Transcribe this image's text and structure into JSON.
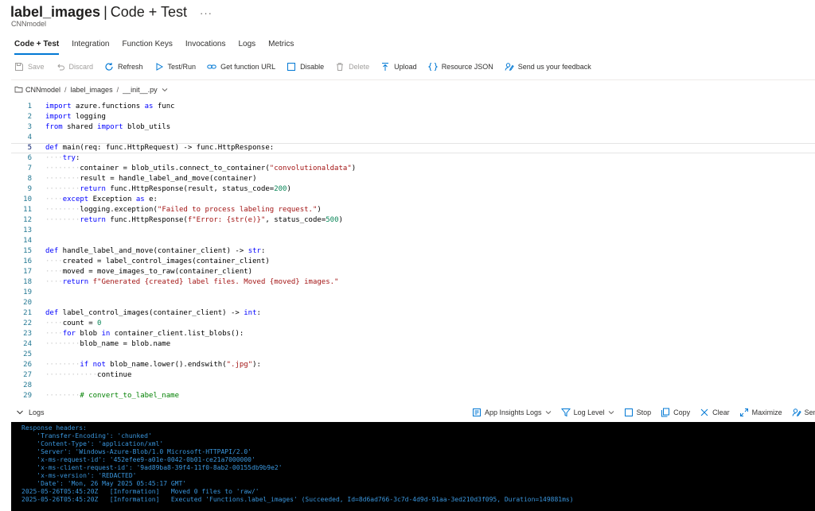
{
  "header": {
    "title": "label_images",
    "separator": "|",
    "title_suffix": "Code + Test",
    "more": "···",
    "subtitle": "CNNmodel"
  },
  "tabs": [
    {
      "label": "Code + Test",
      "active": true
    },
    {
      "label": "Integration"
    },
    {
      "label": "Function Keys"
    },
    {
      "label": "Invocations"
    },
    {
      "label": "Logs"
    },
    {
      "label": "Metrics"
    }
  ],
  "toolbar": {
    "save": "Save",
    "discard": "Discard",
    "refresh": "Refresh",
    "test_run": "Test/Run",
    "get_url": "Get function URL",
    "disable": "Disable",
    "delete": "Delete",
    "upload": "Upload",
    "resource_json": "Resource JSON",
    "feedback": "Send us your feedback"
  },
  "breadcrumb": {
    "root": "CNNmodel",
    "function": "label_images",
    "file": "__init__.py"
  },
  "editor": {
    "current_line": 5,
    "lines": [
      {
        "n": "1",
        "c": "import azure.functions as func"
      },
      {
        "n": "2",
        "c": "import logging"
      },
      {
        "n": "3",
        "c": "from shared import blob_utils"
      },
      {
        "n": "4",
        "c": ""
      },
      {
        "n": "5",
        "c": "def main(req: func.HttpRequest) -> func.HttpResponse:"
      },
      {
        "n": "6",
        "c": "    try:"
      },
      {
        "n": "7",
        "c": "        container = blob_utils.connect_to_container(\"convolutionaldata\")"
      },
      {
        "n": "8",
        "c": "        result = handle_label_and_move(container)"
      },
      {
        "n": "9",
        "c": "        return func.HttpResponse(result, status_code=200)"
      },
      {
        "n": "10",
        "c": "    except Exception as e:"
      },
      {
        "n": "11",
        "c": "        logging.exception(\"Failed to process labeling request.\")"
      },
      {
        "n": "12",
        "c": "        return func.HttpResponse(f\"Error: {str(e)}\", status_code=500)"
      },
      {
        "n": "13",
        "c": ""
      },
      {
        "n": "14",
        "c": ""
      },
      {
        "n": "15",
        "c": "def handle_label_and_move(container_client) -> str:"
      },
      {
        "n": "16",
        "c": "    created = label_control_images(container_client)"
      },
      {
        "n": "17",
        "c": "    moved = move_images_to_raw(container_client)"
      },
      {
        "n": "18",
        "c": "    return f\"Generated {created} label files. Moved {moved} images.\""
      },
      {
        "n": "19",
        "c": ""
      },
      {
        "n": "20",
        "c": ""
      },
      {
        "n": "21",
        "c": "def label_control_images(container_client) -> int:"
      },
      {
        "n": "22",
        "c": "    count = 0"
      },
      {
        "n": "23",
        "c": "    for blob in container_client.list_blobs():"
      },
      {
        "n": "24",
        "c": "        blob_name = blob.name"
      },
      {
        "n": "25",
        "c": ""
      },
      {
        "n": "26",
        "c": "        if not blob_name.lower().endswith(\".jpg\"):"
      },
      {
        "n": "27",
        "c": "            continue"
      },
      {
        "n": "28",
        "c": ""
      },
      {
        "n": "29",
        "c": "        # convert_to_label_name"
      }
    ]
  },
  "logs": {
    "label": "Logs",
    "app_insights": "App Insights Logs",
    "log_level": "Log Level",
    "stop": "Stop",
    "copy": "Copy",
    "clear": "Clear",
    "maximize": "Maximize",
    "feedback": "Send u"
  },
  "console": {
    "lines": [
      "Response headers:",
      "    'Transfer-Encoding': 'chunked'",
      "    'Content-Type': 'application/xml'",
      "    'Server': 'Windows-Azure-Blob/1.0 Microsoft-HTTPAPI/2.0'",
      "    'x-ms-request-id': '452efee9-a01e-0042-0b01-ce21a7000000'",
      "    'x-ms-client-request-id': '9ad89ba8-39f4-11f0-8ab2-00155db9b9e2'",
      "    'x-ms-version': 'REDACTED'",
      "    'Date': 'Mon, 26 May 2025 05:45:17 GMT'",
      "2025-05-26T05:45:20Z   [Information]   Moved 0 files to 'raw/'",
      "2025-05-26T05:45:20Z   [Information]   Executed 'Functions.label_images' (Succeeded, Id=8d6ad766-3c7d-4d9d-91aa-3ed210d3f095, Duration=149881ms)"
    ],
    "color": "#3a96dd"
  },
  "colors": {
    "accent": "#0078d4",
    "console_bg": "#000000"
  }
}
